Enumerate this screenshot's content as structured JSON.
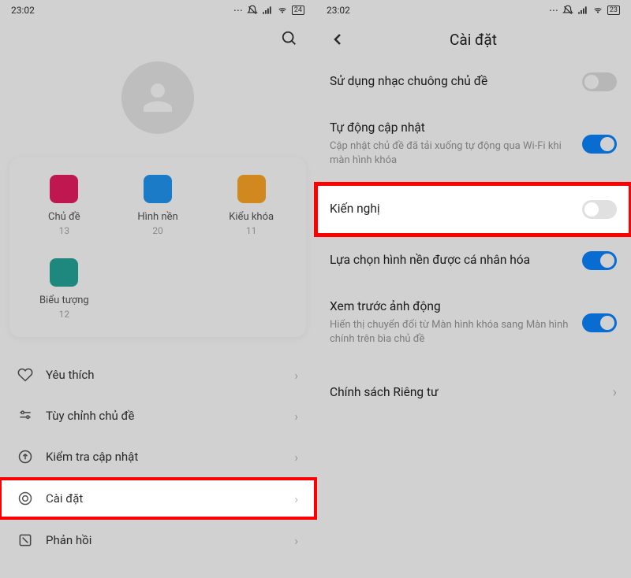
{
  "left": {
    "status": {
      "time": "23:02",
      "battery": "24"
    },
    "grid": [
      {
        "icon": "theme",
        "color": "#e91e63",
        "label": "Chủ đề",
        "count": "13"
      },
      {
        "icon": "wallpaper",
        "color": "#2196f3",
        "label": "Hình nền",
        "count": "20"
      },
      {
        "icon": "lock",
        "color": "#ffa726",
        "label": "Kiểu khóa",
        "count": "11"
      },
      {
        "icon": "iconpack",
        "color": "#26a69a",
        "label": "Biểu tượng",
        "count": "12"
      }
    ],
    "menu": [
      {
        "icon": "heart",
        "label": "Yêu thích"
      },
      {
        "icon": "tune",
        "label": "Tùy chỉnh chủ đề"
      },
      {
        "icon": "update",
        "label": "Kiểm tra cập nhật"
      },
      {
        "icon": "settings",
        "label": "Cài đặt"
      },
      {
        "icon": "feedback",
        "label": "Phản hồi"
      }
    ]
  },
  "right": {
    "status": {
      "time": "23:02",
      "battery": "23"
    },
    "title": "Cài đặt",
    "settings": [
      {
        "title": "Sử dụng nhạc chuông chủ đề",
        "sub": "",
        "toggle": "off"
      },
      {
        "title": "Tự động cập nhật",
        "sub": "Cập nhật chủ đề đã tải xuống tự động qua Wi-Fi khi màn hình khóa",
        "toggle": "on"
      },
      {
        "title": "Kiến nghị",
        "sub": "",
        "toggle": "off"
      },
      {
        "title": "Lựa chọn hình nền được cá nhân hóa",
        "sub": "",
        "toggle": "on"
      },
      {
        "title": "Xem trước ảnh động",
        "sub": "Hiển thị chuyển đổi từ Màn hình khóa sang Màn hình chính trên bìa chủ đề",
        "toggle": "on"
      },
      {
        "title": "Chính sách Riêng tư",
        "sub": "",
        "link": true
      }
    ]
  }
}
